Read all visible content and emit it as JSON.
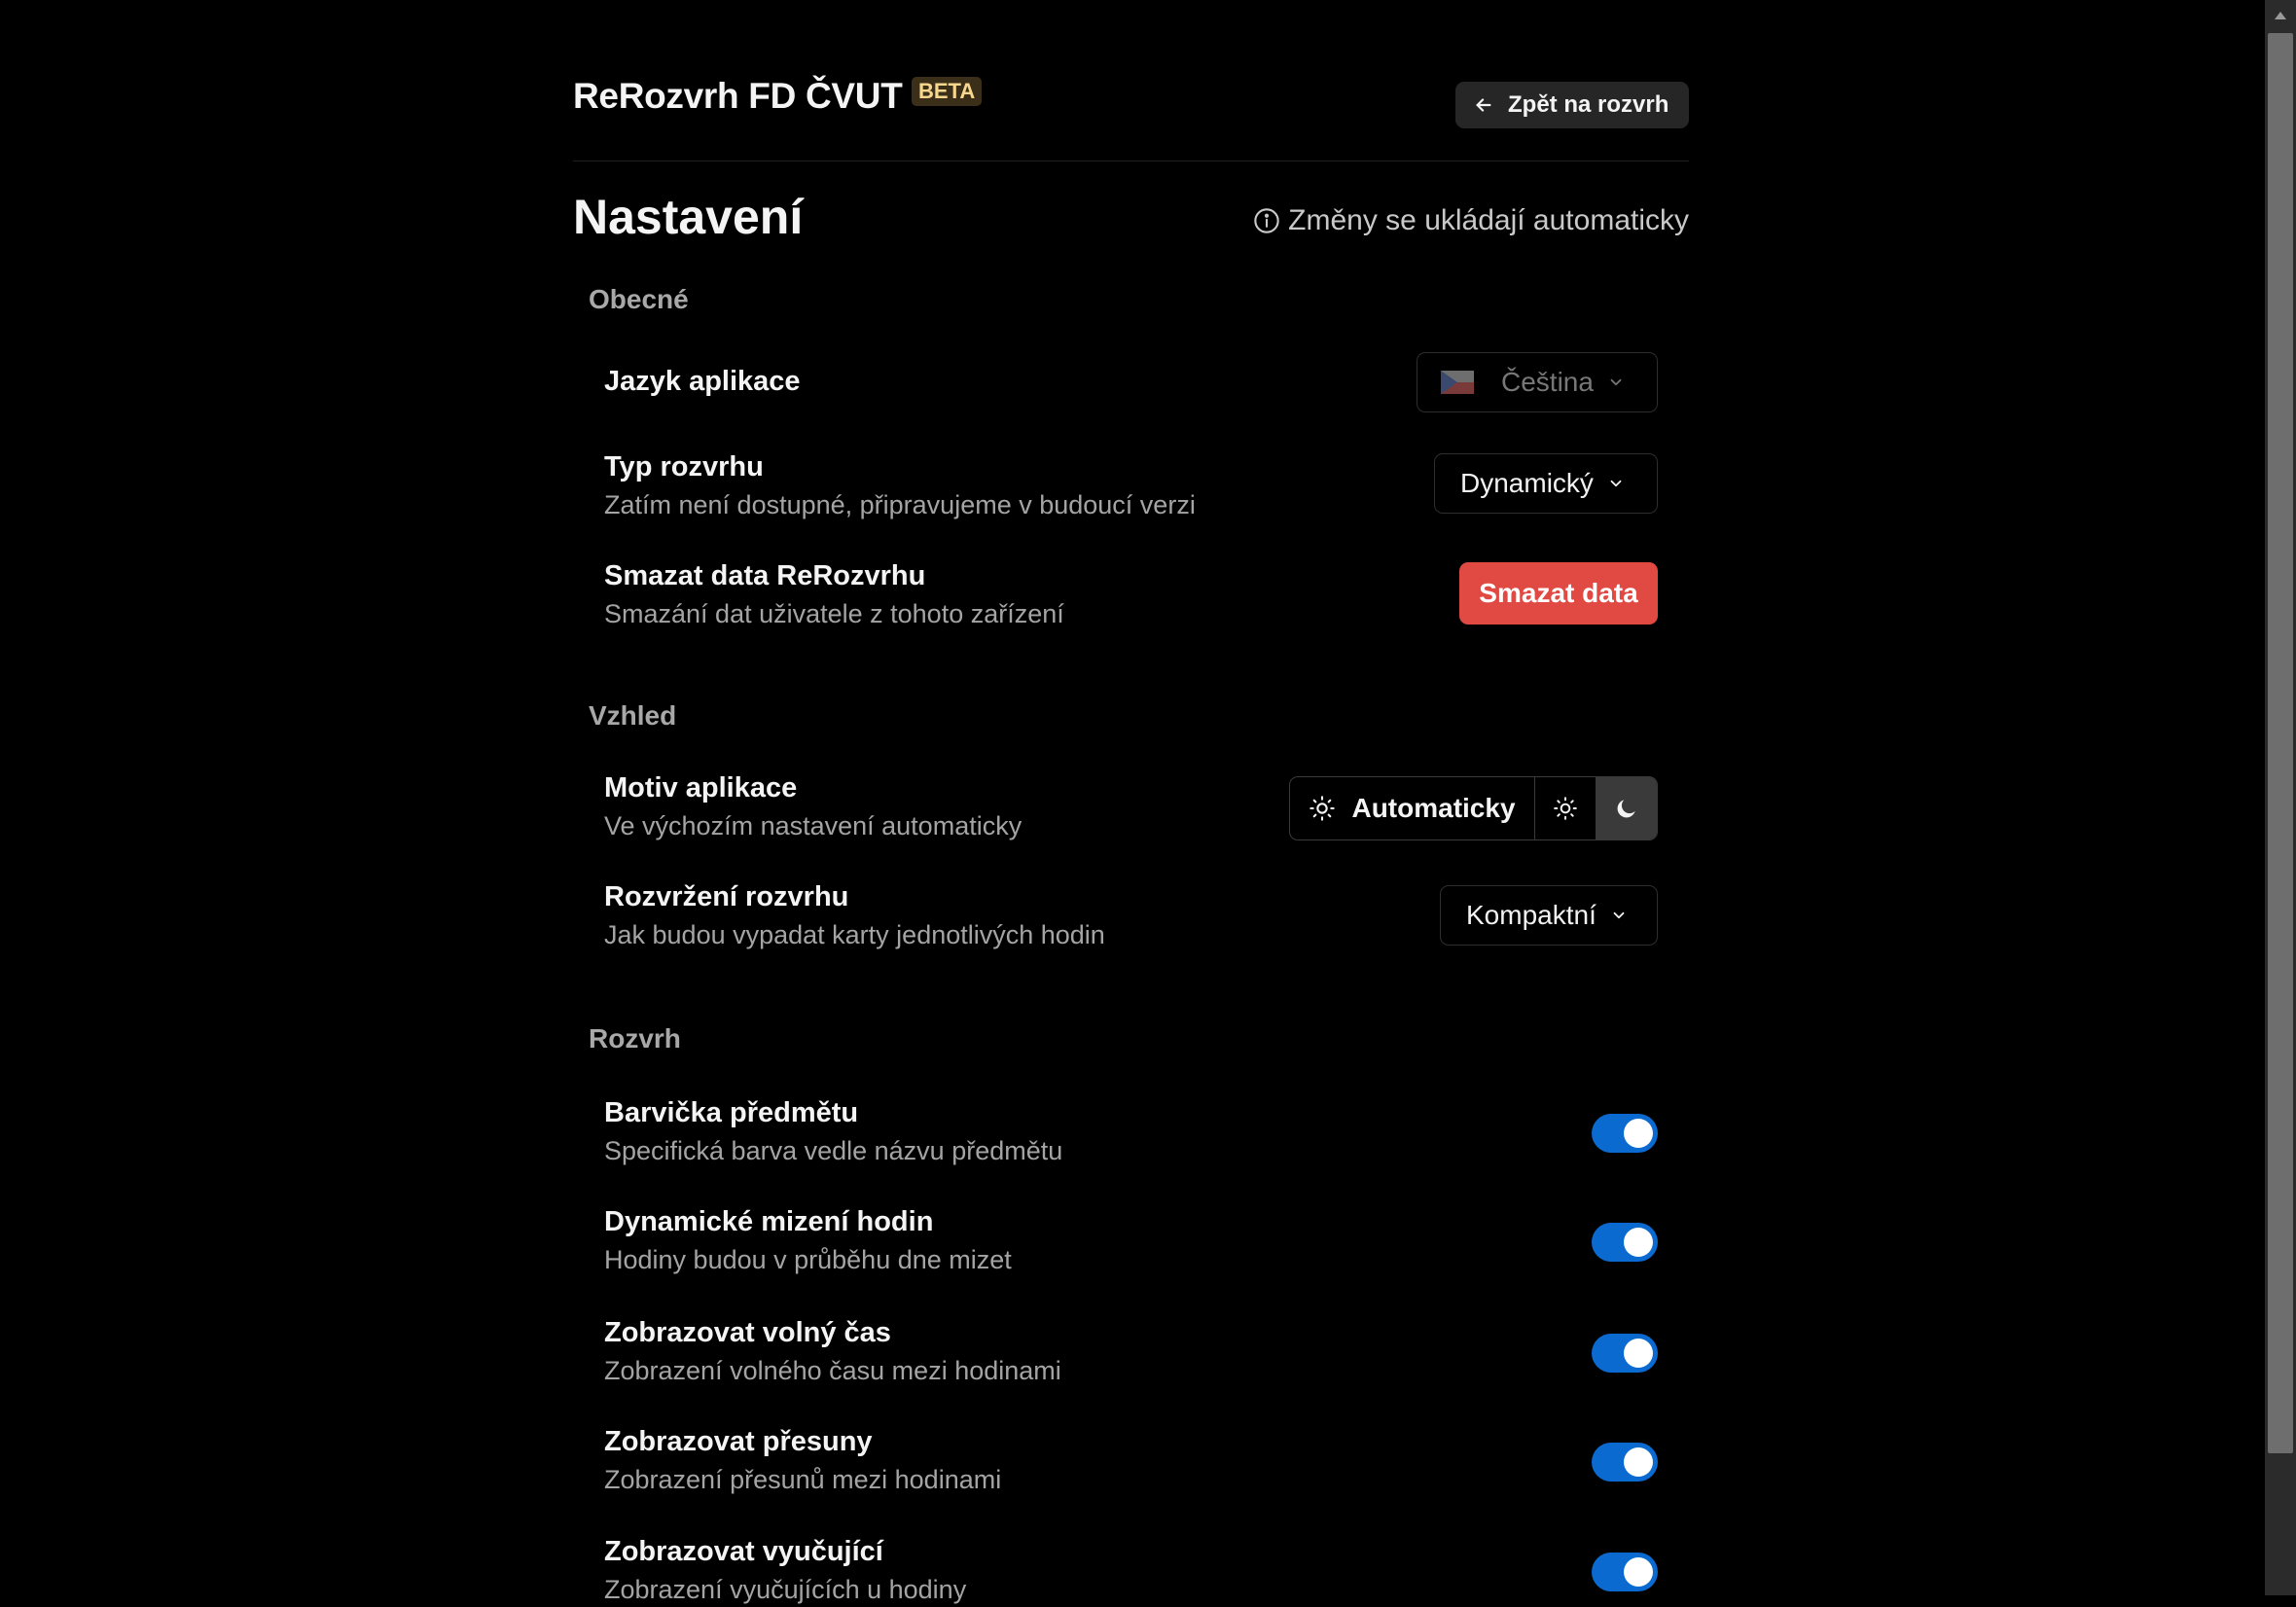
{
  "header": {
    "app_title": "ReRozvrh FD ČVUT",
    "badge": "BETA",
    "back_label": "Zpět na rozvrh"
  },
  "page": {
    "title": "Nastavení",
    "autosave_note": "Změny se ukládají automaticky"
  },
  "sections": {
    "general": {
      "title": "Obecné",
      "language": {
        "label": "Jazyk aplikace",
        "value": "Čeština",
        "flag_icon": "czech-flag-icon"
      },
      "schedule_type": {
        "label": "Typ rozvrhu",
        "desc": "Zatím není dostupné, připravujeme v budoucí verzi",
        "value": "Dynamický"
      },
      "delete_data": {
        "label": "Smazat data ReRozvrhu",
        "desc": "Smazání dat uživatele z tohoto zařízení",
        "button": "Smazat data"
      }
    },
    "appearance": {
      "title": "Vzhled",
      "theme": {
        "label": "Motiv aplikace",
        "desc": "Ve výchozím nastavení automaticky",
        "auto_label": "Automaticky",
        "selected": "dark"
      },
      "layout": {
        "label": "Rozvržení rozvrhu",
        "desc": "Jak budou vypadat karty jednotlivých hodin",
        "value": "Kompaktní"
      }
    },
    "schedule": {
      "title": "Rozvrh",
      "items": [
        {
          "label": "Barvička předmětu",
          "desc": "Specifická barva vedle názvu předmětu",
          "enabled": true
        },
        {
          "label": "Dynamické mizení hodin",
          "desc": "Hodiny budou v průběhu dne mizet",
          "enabled": true
        },
        {
          "label": "Zobrazovat volný čas",
          "desc": "Zobrazení volného času mezi hodinami",
          "enabled": true
        },
        {
          "label": "Zobrazovat přesuny",
          "desc": "Zobrazení přesunů mezi hodinami",
          "enabled": true
        },
        {
          "label": "Zobrazovat vyučující",
          "desc": "Zobrazení vyučujících u hodiny",
          "enabled": true
        }
      ]
    }
  },
  "colors": {
    "background": "#000000",
    "danger": "#e04a43",
    "toggle_on": "#0b6ad0",
    "badge_bg": "#3b2f1a",
    "badge_text": "#f6d78d"
  }
}
